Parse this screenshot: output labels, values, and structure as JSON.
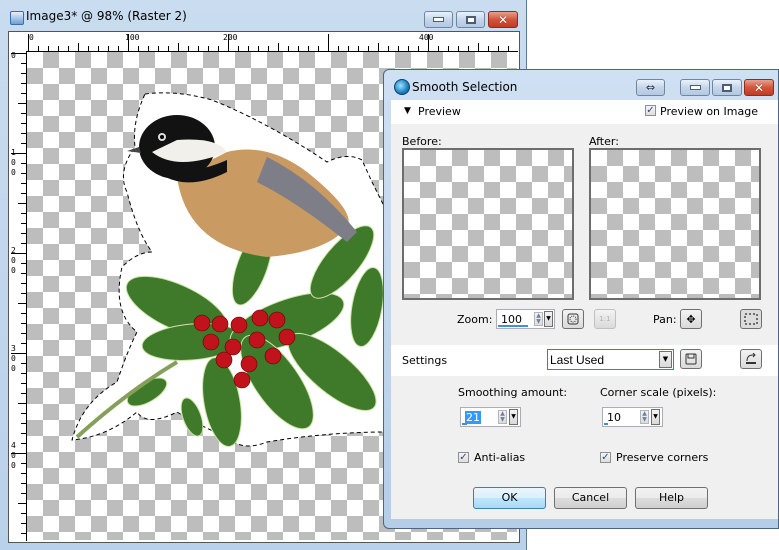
{
  "image_window": {
    "title": "Image3* @  98% (Raster 2)",
    "caption_buttons": [
      "minimize",
      "maximize",
      "close"
    ],
    "ruler_top_labels": [
      "0",
      "100",
      "200",
      "400"
    ],
    "ruler_left_labels": [
      "0",
      "1\n0\n0",
      "2\n0\n0",
      "3\n0\n0",
      "4\n0\n0"
    ],
    "content_description": "Chickadee on holly branch with red berries, selection marquee on transparent background"
  },
  "dialog": {
    "title": "Smooth Selection",
    "preview_section_label": "Preview",
    "preview_on_image_label": "Preview on Image",
    "preview_on_image_checked": true,
    "before_label": "Before:",
    "after_label": "After:",
    "zoom_label": "Zoom:",
    "zoom_value": "100",
    "pan_label": "Pan:",
    "settings_label": "Settings",
    "settings_value": "Last Used",
    "smoothing_label": "Smoothing amount:",
    "smoothing_value": "21",
    "corner_label": "Corner scale (pixels):",
    "corner_value": "10",
    "antialias_label": "Anti-alias",
    "antialias_checked": true,
    "preserve_label": "Preserve corners",
    "preserve_checked": true,
    "ok_label": "OK",
    "cancel_label": "Cancel",
    "help_label": "Help",
    "icons": {
      "collapse": "triangle-down",
      "check": "✓",
      "move": "✥",
      "save": "floppy-disk",
      "reset": "reset-arrow",
      "fit": "zoom-fit",
      "actual": "1:1",
      "select": "marquee",
      "resize": "⇔"
    }
  }
}
